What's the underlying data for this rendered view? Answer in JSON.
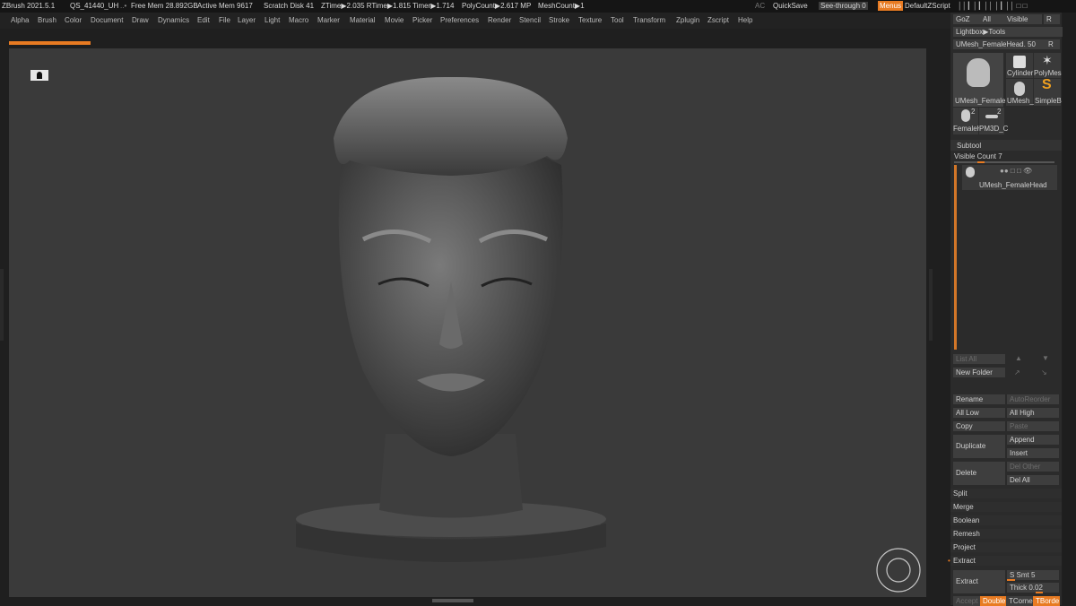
{
  "topbar": {
    "app_title": "ZBrush 2021.5.1",
    "doc_name": "QS_41440_UH",
    "free_mem": "Free Mem 28.892GB",
    "active_mem": "Active Mem 9617",
    "scratch": "Scratch Disk 41",
    "ztime": "ZTime▶2.035 RTime▶1.815 Timer▶1.714",
    "polycount": "PolyCount▶2.617 MP",
    "meshcount": "MeshCount▶1",
    "ac": "AC",
    "quicksave": "QuickSave",
    "seethrough": "See-through",
    "seethrough_value": "0",
    "menus": "Menus",
    "script": "DefaultZScript"
  },
  "menu": [
    "Alpha",
    "Brush",
    "Color",
    "Document",
    "Draw",
    "Dynamics",
    "Edit",
    "File",
    "Layer",
    "Light",
    "Macro",
    "Marker",
    "Material",
    "Movie",
    "Picker",
    "Preferences",
    "Render",
    "Stencil",
    "Stroke",
    "Texture",
    "Tool",
    "Transform",
    "Zplugin",
    "Zscript",
    "Help"
  ],
  "tool": {
    "goz": "GoZ",
    "all": "All",
    "visible": "Visible",
    "r": "R",
    "lightbox": "Lightbox▶Tools",
    "current_tool": "UMesh_FemaleHead. 50",
    "r2": "R",
    "thumbs": {
      "main": "UMesh_FemaleH",
      "cylinder": "Cylinder",
      "polymesh": "PolyMes",
      "umesh": "UMesh_",
      "simpleb": "SimpleB",
      "femaleh": "FemaleH",
      "pm3d": "PM3D_C",
      "count2a": "2",
      "count2b": "2"
    }
  },
  "subtool": {
    "header": "Subtool",
    "visible_count": "Visible Count 7",
    "item_name": "UMesh_FemaleHead",
    "list_all": "List All",
    "new_folder": "New Folder",
    "rename": "Rename",
    "autoreorder": "AutoReorder",
    "all_low": "All Low",
    "all_high": "All High",
    "copy": "Copy",
    "paste": "Paste",
    "duplicate": "Duplicate",
    "append": "Append",
    "insert": "Insert",
    "delete": "Delete",
    "del_other": "Del Other",
    "del_all": "Del All",
    "split": "Split",
    "merge": "Merge",
    "boolean": "Boolean",
    "remesh": "Remesh",
    "project": "Project",
    "extract_header": "Extract",
    "extract": "Extract",
    "smt": "S Smt 5",
    "thick": "Thick 0.02",
    "accept": "Accept",
    "double": "Double",
    "tcorner": "TCorne",
    "tborder": "TBorde"
  },
  "colors": {
    "accent": "#e87b22",
    "viewport": "#3a3a3a",
    "panel": "#2b2b2b"
  }
}
